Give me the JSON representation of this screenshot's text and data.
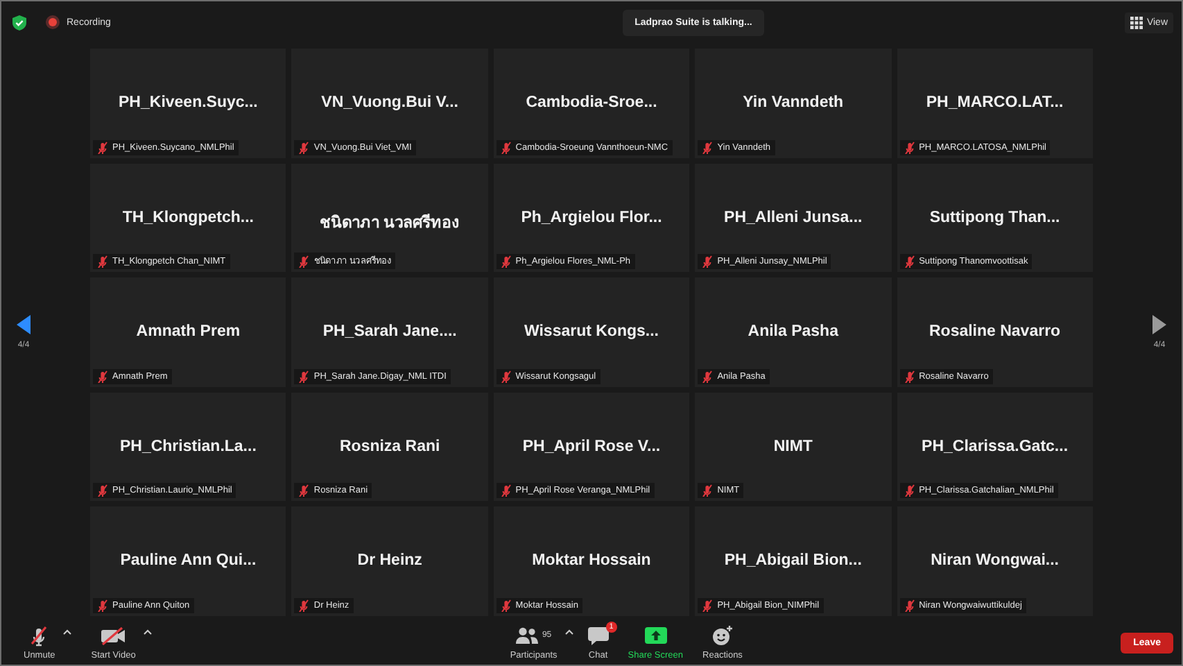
{
  "top_bar": {
    "recording_label": "Recording",
    "talking_banner": "Ladprao Suite is talking...",
    "view_button": "View"
  },
  "pager": {
    "previous": {
      "page": "4/4",
      "enabled": true
    },
    "next": {
      "page": "4/4",
      "enabled": false
    }
  },
  "tiles": [
    {
      "display_name": "PH_Kiveen.Suyc...",
      "name_tag": "PH_Kiveen.Suycano_NMLPhil",
      "muted": true
    },
    {
      "display_name": "VN_Vuong.Bui  V...",
      "name_tag": "VN_Vuong.Bui Viet_VMI",
      "muted": true
    },
    {
      "display_name": "Cambodia-Sroe...",
      "name_tag": "Cambodia-Sroeung Vannthoeun-NMC",
      "muted": true
    },
    {
      "display_name": "Yin Vanndeth",
      "name_tag": "Yin Vanndeth",
      "muted": true
    },
    {
      "display_name": "PH_MARCO.LAT...",
      "name_tag": "PH_MARCO.LATOSA_NMLPhil",
      "muted": true
    },
    {
      "display_name": "TH_Klongpetch...",
      "name_tag": "TH_Klongpetch Chan_NIMT",
      "muted": true
    },
    {
      "display_name": "ชนิดาภา นวลศรีทอง",
      "name_tag": "ชนิดาภา นวลศรีทอง",
      "muted": true
    },
    {
      "display_name": "Ph_Argielou  Flor...",
      "name_tag": "Ph_Argielou Flores_NML-Ph",
      "muted": true
    },
    {
      "display_name": "PH_Alleni  Junsa...",
      "name_tag": "PH_Alleni Junsay_NMLPhil",
      "muted": true
    },
    {
      "display_name": "Suttipong  Than...",
      "name_tag": "Suttipong Thanomvoottisak",
      "muted": true
    },
    {
      "display_name": "Amnath Prem",
      "name_tag": "Amnath Prem",
      "muted": true
    },
    {
      "display_name": "PH_Sarah  Jane....",
      "name_tag": "PH_Sarah Jane.Digay_NML ITDI",
      "muted": true
    },
    {
      "display_name": "Wissarut  Kongs...",
      "name_tag": "Wissarut Kongsagul",
      "muted": true
    },
    {
      "display_name": "Anila Pasha",
      "name_tag": "Anila Pasha",
      "muted": true
    },
    {
      "display_name": "Rosaline Navarro",
      "name_tag": "Rosaline Navarro",
      "muted": true
    },
    {
      "display_name": "PH_Christian.La...",
      "name_tag": "PH_Christian.Laurio_NMLPhil",
      "muted": true
    },
    {
      "display_name": "Rosniza Rani",
      "name_tag": "Rosniza Rani",
      "muted": true
    },
    {
      "display_name": "PH_April  Rose  V...",
      "name_tag": "PH_April Rose Veranga_NMLPhil",
      "muted": true
    },
    {
      "display_name": "NIMT",
      "name_tag": "NIMT",
      "muted": true
    },
    {
      "display_name": "PH_Clarissa.Gatc...",
      "name_tag": "PH_Clarissa.Gatchalian_NMLPhil",
      "muted": true
    },
    {
      "display_name": "Pauline  Ann  Qui...",
      "name_tag": "Pauline Ann Quiton",
      "muted": true
    },
    {
      "display_name": "Dr Heinz",
      "name_tag": "Dr Heinz",
      "muted": true
    },
    {
      "display_name": "Moktar Hossain",
      "name_tag": "Moktar Hossain",
      "muted": true
    },
    {
      "display_name": "PH_Abigail  Bion...",
      "name_tag": "PH_Abigail Bion_NIMPhil",
      "muted": true
    },
    {
      "display_name": "Niran  Wongwai...",
      "name_tag": "Niran Wongwaiwuttikuldej",
      "muted": true
    }
  ],
  "toolbar": {
    "left": [
      {
        "kind": "audio",
        "label": "Unmute",
        "off": true,
        "menu_caret": true
      },
      {
        "kind": "video",
        "label": "Start Video",
        "off": true,
        "menu_caret": true
      }
    ],
    "center": [
      {
        "kind": "participants",
        "label": "Participants",
        "count": "95",
        "menu_caret": true
      },
      {
        "kind": "chat",
        "label": "Chat",
        "badge": "1",
        "menu_caret": false
      },
      {
        "kind": "share",
        "label": "Share Screen",
        "menu_caret": false
      },
      {
        "kind": "reactions",
        "label": "Reactions",
        "menu_caret": false
      }
    ],
    "leave_button": "Leave"
  }
}
